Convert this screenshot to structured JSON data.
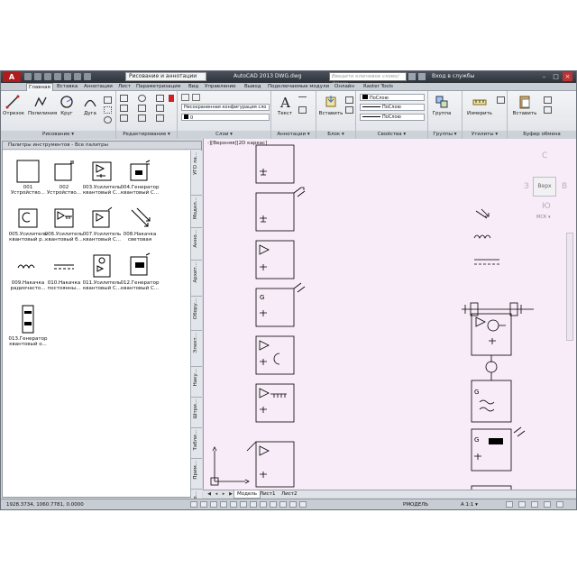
{
  "titlebar": {
    "workspace": "Рисование и аннотации",
    "title": "AutoCAD 2013    DWG.dwg",
    "search_placeholder": "Введите ключевое слово/фразу",
    "login": "Вход в службы"
  },
  "tabs": [
    "Главная",
    "Вставка",
    "Аннотации",
    "Лист",
    "Параметризация",
    "Вид",
    "Управление",
    "Вывод",
    "Подключаемые модули",
    "Онлайн",
    "Raster Tools"
  ],
  "ribbon": {
    "draw": {
      "title": "Рисование ▾",
      "buttons": [
        "Отрезок",
        "Полилиния",
        "Круг",
        "Дуга"
      ]
    },
    "modify": {
      "title": "Редактирование ▾"
    },
    "layers": {
      "title": "Слои ▾",
      "layer_state": "Несохраненная конфигурация сло",
      "layer_name": "0"
    },
    "annotation": {
      "title": "Аннотации ▾",
      "button": "Текст"
    },
    "block": {
      "title": "Блок ▾",
      "button": "Вставить"
    },
    "properties": {
      "title": "Свойства ▾",
      "color": "ПоСлою",
      "linetype": "ПоСлою",
      "lineweight": "ПоСлою"
    },
    "groups": {
      "title": "Группы ▾",
      "button": "Группа"
    },
    "utilities": {
      "title": "Утилиты ▾",
      "button": "Измерить"
    },
    "clipboard": {
      "title": "Буфер обмена",
      "button": "Вставить"
    }
  },
  "palette": {
    "header": "Палитры инструментов - Все палитры",
    "tools": [
      "001\nУстройство...",
      "002\nУстройство...",
      "003.Усилитель\nквантовый С...",
      "004.Генератор\nквантовый С...",
      "005.Усилитель\nквантовый р...",
      "006.Усилитель\nквантовый б...",
      "007.Усилитель\nквантовый С...",
      "008.Накачка\nсветовая",
      "009.Накачка\nрадиочасто...",
      "010.Накачка\nпостоянны...",
      "011.Усилитель\nквантовый С...",
      "012.Генератор\nквантовый С...",
      "013.Генератор\nквантовый о..."
    ],
    "side_tabs": [
      "УГО ла...",
      "Модел...",
      "Анно...",
      "Архит...",
      "Обору...",
      "Элект...",
      "Наку...",
      "Штри...",
      "Табли...",
      "Прим...",
      "Выно...",
      "Чертёж"
    ]
  },
  "canvas": {
    "viewport_label": "-][Верхняя][2D каркас]",
    "compass": {
      "n": "С",
      "s": "Ю",
      "w": "З",
      "e": "В",
      "top": "Верх",
      "wcs": "МСК ▾"
    }
  },
  "layout_tabs": [
    "Модель",
    "Лист1",
    "Лист2"
  ],
  "status": {
    "coords": "1928.3734, 1060.7781, 0.0000",
    "model": "РМОДЕЛЬ",
    "scale": "А 1:1 ▾"
  }
}
